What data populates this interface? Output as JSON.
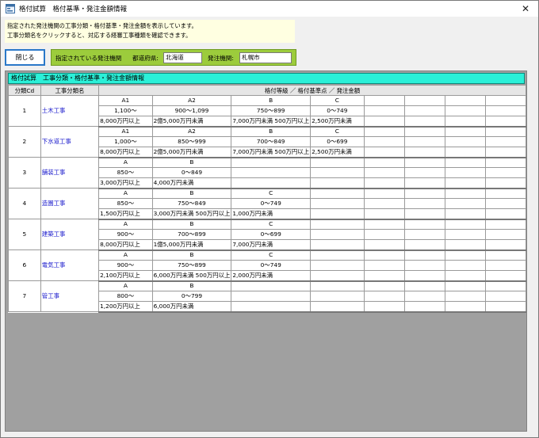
{
  "window": {
    "title": "格付試算　格付基準・発注金額情報"
  },
  "instructions": {
    "line1": "指定された発注機関の工事分類・格付基準・発注金額を表示しています。",
    "line2": "工事分類名をクリックすると、対応する経審工事種類を確認できます。"
  },
  "toolbar": {
    "close_label": "閉じる"
  },
  "issuer": {
    "heading": "指定されている発注機関",
    "pref_label": "都道府県:",
    "pref_value": "北海道",
    "org_label": "発注機関:",
    "org_value": "札幌市"
  },
  "grid": {
    "title": "格付試算　工事分類・格付基準・発注金額情報",
    "col_no": "分類Cd",
    "col_name": "工事分類名",
    "col_rank": "格付等級 ／ 格付基準点 ／ 発注金額",
    "rows": [
      {
        "no": "1",
        "name": "土木工事",
        "grades": [
          "A1",
          "A2",
          "B",
          "C",
          "",
          "",
          "",
          ""
        ],
        "points": [
          "1,100〜",
          "900〜1,099",
          "750〜899",
          "0〜749",
          "",
          "",
          "",
          ""
        ],
        "amounts": [
          "8,000万円以上",
          "2億5,000万円未満",
          "7,000万円未満 500万円以上",
          "2,500万円未満",
          "",
          "",
          "",
          ""
        ]
      },
      {
        "no": "2",
        "name": "下水道工事",
        "grades": [
          "A1",
          "A2",
          "B",
          "C",
          "",
          "",
          "",
          ""
        ],
        "points": [
          "1,000〜",
          "850〜999",
          "700〜849",
          "0〜699",
          "",
          "",
          "",
          ""
        ],
        "amounts": [
          "8,000万円以上",
          "2億5,000万円未満",
          "7,000万円未満 500万円以上",
          "2,500万円未満",
          "",
          "",
          "",
          ""
        ]
      },
      {
        "no": "3",
        "name": "舗装工事",
        "grades": [
          "A",
          "B",
          "",
          "",
          "",
          "",
          "",
          ""
        ],
        "points": [
          "850〜",
          "0〜849",
          "",
          "",
          "",
          "",
          "",
          ""
        ],
        "amounts": [
          "3,000万円以上",
          "4,000万円未満",
          "",
          "",
          "",
          "",
          "",
          ""
        ]
      },
      {
        "no": "4",
        "name": "造園工事",
        "grades": [
          "A",
          "B",
          "C",
          "",
          "",
          "",
          "",
          ""
        ],
        "points": [
          "850〜",
          "750〜849",
          "0〜749",
          "",
          "",
          "",
          "",
          ""
        ],
        "amounts": [
          "1,500万円以上",
          "3,000万円未満 500万円以上",
          "1,000万円未満",
          "",
          "",
          "",
          "",
          ""
        ]
      },
      {
        "no": "5",
        "name": "建築工事",
        "grades": [
          "A",
          "B",
          "C",
          "",
          "",
          "",
          "",
          ""
        ],
        "points": [
          "900〜",
          "700〜899",
          "0〜699",
          "",
          "",
          "",
          "",
          ""
        ],
        "amounts": [
          "8,000万円以上",
          "1億5,000万円未満",
          "7,000万円未満",
          "",
          "",
          "",
          "",
          ""
        ]
      },
      {
        "no": "6",
        "name": "電気工事",
        "grades": [
          "A",
          "B",
          "C",
          "",
          "",
          "",
          "",
          ""
        ],
        "points": [
          "900〜",
          "750〜899",
          "0〜749",
          "",
          "",
          "",
          "",
          ""
        ],
        "amounts": [
          "2,100万円以上",
          "6,000万円未満 500万円以上",
          "2,000万円未満",
          "",
          "",
          "",
          "",
          ""
        ]
      },
      {
        "no": "7",
        "name": "管工事",
        "grades": [
          "A",
          "B",
          "",
          "",
          "",
          "",
          "",
          ""
        ],
        "points": [
          "800〜",
          "0〜799",
          "",
          "",
          "",
          "",
          "",
          ""
        ],
        "amounts": [
          "1,200万円以上",
          "6,000万円未満",
          "",
          "",
          "",
          "",
          "",
          ""
        ]
      }
    ]
  }
}
